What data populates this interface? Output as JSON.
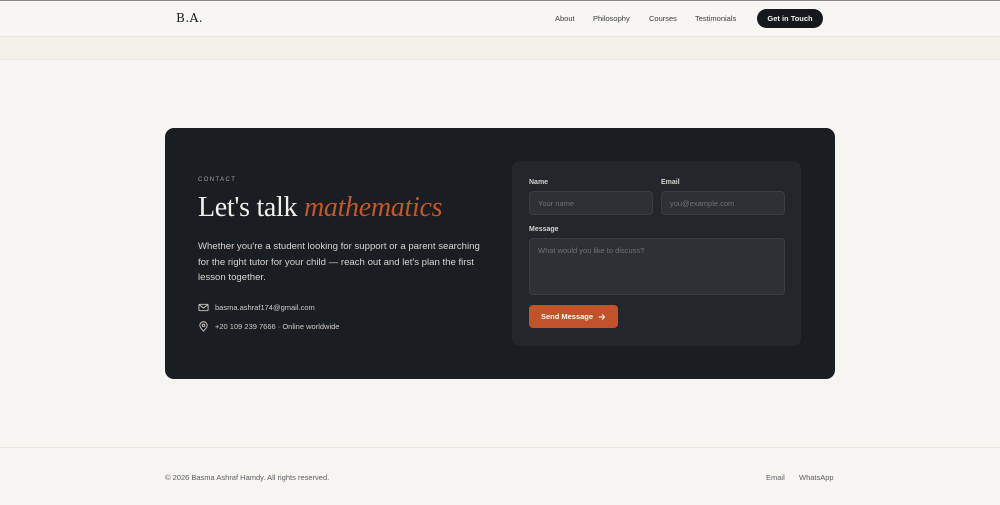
{
  "header": {
    "logo": "B.A.",
    "nav": [
      "About",
      "Philosophy",
      "Courses",
      "Testimonials"
    ],
    "cta_label": "Get in Touch"
  },
  "contact": {
    "eyebrow": "CONTACT",
    "headline_plain": "Let's talk",
    "headline_accent": "mathematics",
    "lead": "Whether you're a student looking for support or a parent searching for the right tutor for your child — reach out and let's plan the first lesson together.",
    "email": "basma.ashraf174@gmail.com",
    "phone_location": "+20 109 239 7666 · Online worldwide",
    "form": {
      "name_label": "Name",
      "name_placeholder": "Your name",
      "email_label": "Email",
      "email_placeholder": "you@example.com",
      "message_label": "Message",
      "message_placeholder": "What would you like to discuss?",
      "submit_label": "Send Message"
    }
  },
  "footer": {
    "copyright": "© 2026 Basma Ashraf Hamdy. All rights reserved.",
    "links": [
      "Email",
      "WhatsApp"
    ]
  },
  "colors": {
    "accent": "#c0532a",
    "dark": "#1a1d21",
    "background": "#f7f5f1"
  }
}
